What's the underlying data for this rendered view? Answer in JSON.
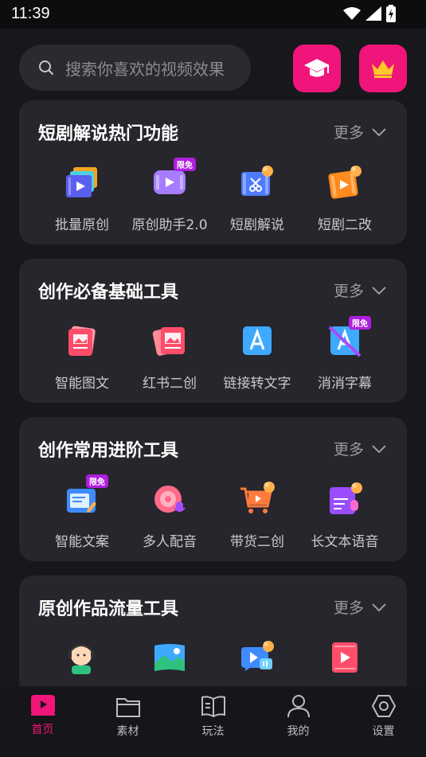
{
  "status": {
    "time": "11:39"
  },
  "search": {
    "placeholder": "搜索你喜欢的视频效果"
  },
  "cards": [
    {
      "title": "短剧解说热门功能",
      "more": "更多",
      "tools": [
        {
          "label": "批量原创",
          "icon": "batch-video-icon"
        },
        {
          "label": "原创助手2.0",
          "icon": "original-assistant-icon",
          "badge": "限免"
        },
        {
          "label": "短剧解说",
          "icon": "drama-commentary-icon"
        },
        {
          "label": "短剧二改",
          "icon": "drama-remix-icon"
        }
      ]
    },
    {
      "title": "创作必备基础工具",
      "more": "更多",
      "tools": [
        {
          "label": "智能图文",
          "icon": "smart-image-text-icon"
        },
        {
          "label": "红书二创",
          "icon": "redbook-remix-icon"
        },
        {
          "label": "链接转文字",
          "icon": "link-to-text-icon"
        },
        {
          "label": "消消字幕",
          "icon": "remove-subtitle-icon",
          "badge": "限免"
        }
      ]
    },
    {
      "title": "创作常用进阶工具",
      "more": "更多",
      "tools": [
        {
          "label": "智能文案",
          "icon": "smart-copywriting-icon",
          "badge": "限免"
        },
        {
          "label": "多人配音",
          "icon": "multi-voice-icon"
        },
        {
          "label": "带货二创",
          "icon": "shopping-remix-icon"
        },
        {
          "label": "长文本语音",
          "icon": "long-text-voice-icon"
        }
      ]
    },
    {
      "title": "原创作品流量工具",
      "more": "更多",
      "tools": [
        {
          "label": "",
          "icon": "kid-avatar-icon"
        },
        {
          "label": "",
          "icon": "landscape-icon"
        },
        {
          "label": "",
          "icon": "video-voice-icon"
        },
        {
          "label": "",
          "icon": "video-card-icon"
        }
      ]
    }
  ],
  "nav": [
    {
      "label": "首页",
      "icon": "home-play-icon"
    },
    {
      "label": "素材",
      "icon": "folder-icon"
    },
    {
      "label": "玩法",
      "icon": "book-icon"
    },
    {
      "label": "我的",
      "icon": "person-icon"
    },
    {
      "label": "设置",
      "icon": "settings-hex-icon"
    }
  ],
  "colors": {
    "accent": "#f0157a",
    "background": "#18181c",
    "card": "#26262c",
    "badge": "#b11ee0"
  }
}
